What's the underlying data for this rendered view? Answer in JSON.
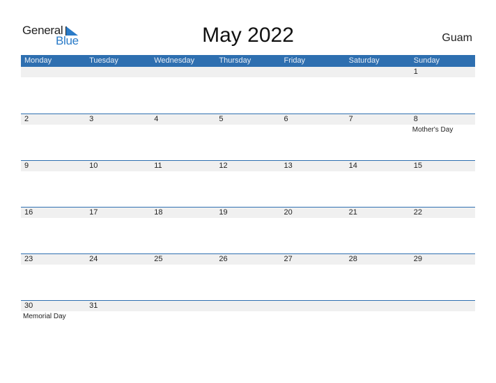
{
  "logo": {
    "general": "General",
    "blue": "Blue"
  },
  "title": "May 2022",
  "region": "Guam",
  "colors": {
    "accent": "#2e6fb0",
    "date_bar": "#f0f0f0"
  },
  "weekdays": [
    "Monday",
    "Tuesday",
    "Wednesday",
    "Thursday",
    "Friday",
    "Saturday",
    "Sunday"
  ],
  "weeks": [
    {
      "days": [
        "",
        "",
        "",
        "",
        "",
        "",
        "1"
      ],
      "events": [
        "",
        "",
        "",
        "",
        "",
        "",
        ""
      ]
    },
    {
      "days": [
        "2",
        "3",
        "4",
        "5",
        "6",
        "7",
        "8"
      ],
      "events": [
        "",
        "",
        "",
        "",
        "",
        "",
        "Mother's Day"
      ]
    },
    {
      "days": [
        "9",
        "10",
        "11",
        "12",
        "13",
        "14",
        "15"
      ],
      "events": [
        "",
        "",
        "",
        "",
        "",
        "",
        ""
      ]
    },
    {
      "days": [
        "16",
        "17",
        "18",
        "19",
        "20",
        "21",
        "22"
      ],
      "events": [
        "",
        "",
        "",
        "",
        "",
        "",
        ""
      ]
    },
    {
      "days": [
        "23",
        "24",
        "25",
        "26",
        "27",
        "28",
        "29"
      ],
      "events": [
        "",
        "",
        "",
        "",
        "",
        "",
        ""
      ]
    },
    {
      "days": [
        "30",
        "31",
        "",
        "",
        "",
        "",
        ""
      ],
      "events": [
        "Memorial Day",
        "",
        "",
        "",
        "",
        "",
        ""
      ]
    }
  ]
}
